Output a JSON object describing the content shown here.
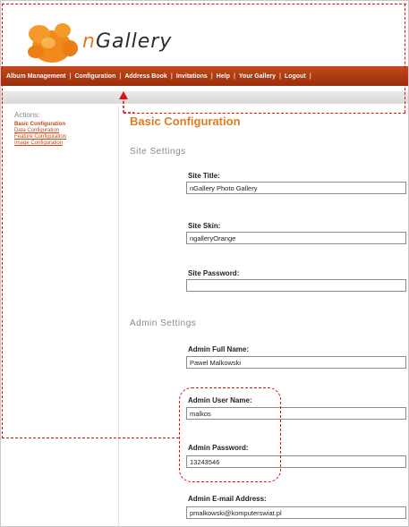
{
  "app": {
    "name_prefix": "n",
    "name_rest": "Gallery"
  },
  "nav": {
    "items": [
      "Album Management",
      "Configuration",
      "Address Book",
      "Invitations",
      "Help",
      "Your Gallery",
      "Logout"
    ],
    "separator": "|"
  },
  "sidebar": {
    "heading": "Actions:",
    "links": [
      "Basic Configuration",
      "Data Configuration",
      "Feature Configuration",
      "Image Configuration"
    ]
  },
  "main": {
    "title": "Basic Configuration",
    "site_section": "Site Settings",
    "admin_section": "Admin Settings",
    "fields": {
      "site_title": {
        "label": "Site Title:",
        "value": "nGallery Photo Gallery"
      },
      "site_skin": {
        "label": "Site Skin:",
        "value": "ngalleryOrange"
      },
      "site_password": {
        "label": "Site Password:",
        "value": ""
      },
      "admin_full_name": {
        "label": "Admin Full Name:",
        "value": "Pawel Malkowski"
      },
      "admin_user_name": {
        "label": "Admin User Name:",
        "value": "malkos"
      },
      "admin_password": {
        "label": "Admin Password:",
        "value": "13243546"
      },
      "admin_email": {
        "label": "Admin E-mail Address:",
        "value": "pmalkowski@komputerswiat.pl"
      }
    }
  },
  "colors": {
    "accent": "#e07c1e",
    "navbar": "#b13a13",
    "annotation": "#dd1111"
  }
}
